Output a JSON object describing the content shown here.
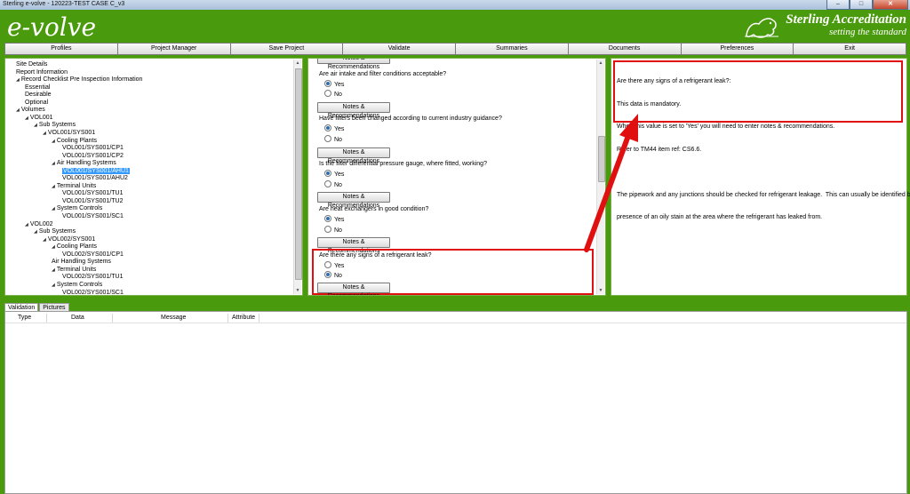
{
  "window": {
    "title": "Sterling e-volve - 120223-TEST CASE C_v3",
    "controls": [
      "–",
      "□",
      "✕"
    ]
  },
  "header": {
    "logo": "e-volve",
    "brand_name": "Sterling Accreditation",
    "brand_tagline": "setting the standard"
  },
  "menu": [
    "Profiles",
    "Project Manager",
    "Save Project",
    "Validate",
    "Summaries",
    "Documents",
    "Preferences",
    "Exit"
  ],
  "tree": [
    {
      "label": "Site Details",
      "depth": 0,
      "arrow": false
    },
    {
      "label": "Report Information",
      "depth": 0,
      "arrow": false
    },
    {
      "label": "Record Checklist Pre Inspection Information",
      "depth": 0,
      "arrow": true
    },
    {
      "label": "Essential",
      "depth": 1,
      "arrow": false
    },
    {
      "label": "Desirable",
      "depth": 1,
      "arrow": false
    },
    {
      "label": "Optional",
      "depth": 1,
      "arrow": false
    },
    {
      "label": "Volumes",
      "depth": 0,
      "arrow": true
    },
    {
      "label": "VOL001",
      "depth": 1,
      "arrow": true
    },
    {
      "label": "Sub Systems",
      "depth": 2,
      "arrow": true
    },
    {
      "label": "VOL001/SYS001",
      "depth": 3,
      "arrow": true
    },
    {
      "label": "Cooling Plants",
      "depth": 4,
      "arrow": true
    },
    {
      "label": "VOL001/SYS001/CP1",
      "depth": 5,
      "arrow": false
    },
    {
      "label": "VOL001/SYS001/CP2",
      "depth": 5,
      "arrow": false
    },
    {
      "label": "Air Handling Systems",
      "depth": 4,
      "arrow": true
    },
    {
      "label": "VOL001/SYS001/AHU1",
      "depth": 5,
      "arrow": false,
      "selected": true
    },
    {
      "label": "VOL001/SYS001/AHU2",
      "depth": 5,
      "arrow": false
    },
    {
      "label": "Terminal Units",
      "depth": 4,
      "arrow": true
    },
    {
      "label": "VOL001/SYS001/TU1",
      "depth": 5,
      "arrow": false
    },
    {
      "label": "VOL001/SYS001/TU2",
      "depth": 5,
      "arrow": false
    },
    {
      "label": "System Controls",
      "depth": 4,
      "arrow": true
    },
    {
      "label": "VOL001/SYS001/SC1",
      "depth": 5,
      "arrow": false
    },
    {
      "label": "VOL002",
      "depth": 1,
      "arrow": true
    },
    {
      "label": "Sub Systems",
      "depth": 2,
      "arrow": true
    },
    {
      "label": "VOL002/SYS001",
      "depth": 3,
      "arrow": true
    },
    {
      "label": "Cooling Plants",
      "depth": 4,
      "arrow": true
    },
    {
      "label": "VOL002/SYS001/CP1",
      "depth": 5,
      "arrow": false
    },
    {
      "label": "Air Handling Systems",
      "depth": 4,
      "arrow": false
    },
    {
      "label": "Terminal Units",
      "depth": 4,
      "arrow": true
    },
    {
      "label": "VOL002/SYS001/TU1",
      "depth": 5,
      "arrow": false
    },
    {
      "label": "System Controls",
      "depth": 4,
      "arrow": true
    },
    {
      "label": "VOL002/SYS001/SC1",
      "depth": 5,
      "arrow": false
    }
  ],
  "questions": {
    "notes_label": "Notes & Recommendations",
    "yes_label": "Yes",
    "no_label": "No",
    "items": [
      {
        "text": "Are air intake and filter conditions acceptable?",
        "answer": "Yes"
      },
      {
        "text": "Have filters been changed according to current industry guidance?",
        "answer": "Yes"
      },
      {
        "text": "Is the filter differential pressure gauge, where fitted, working?",
        "answer": "Yes"
      },
      {
        "text": "Are heat exchangers in good condition?",
        "answer": "Yes"
      },
      {
        "text": "Are there any signs of a refrigerant leak?",
        "answer": "No"
      }
    ]
  },
  "help": {
    "lines": [
      "Are there any signs of a refrigerant leak?:",
      "This data is mandatory.",
      "When this value is set to 'Yes' you will need to enter notes & recommendations.",
      "Refer to TM44 item ref: CS6.6.",
      "",
      "The pipework and any junctions should be checked for refrigerant leakage.  This can usually be identified by the",
      "presence of an oily stain at the area where the refrigerant has leaked from."
    ]
  },
  "bottom_tabs": [
    "Validation",
    "Pictures"
  ],
  "validation_columns": [
    "Type",
    "Data",
    "Message",
    "Attribute"
  ],
  "colors": {
    "frame": "#4a9a0e",
    "highlight": "#e01010",
    "selection": "#3399ff"
  }
}
